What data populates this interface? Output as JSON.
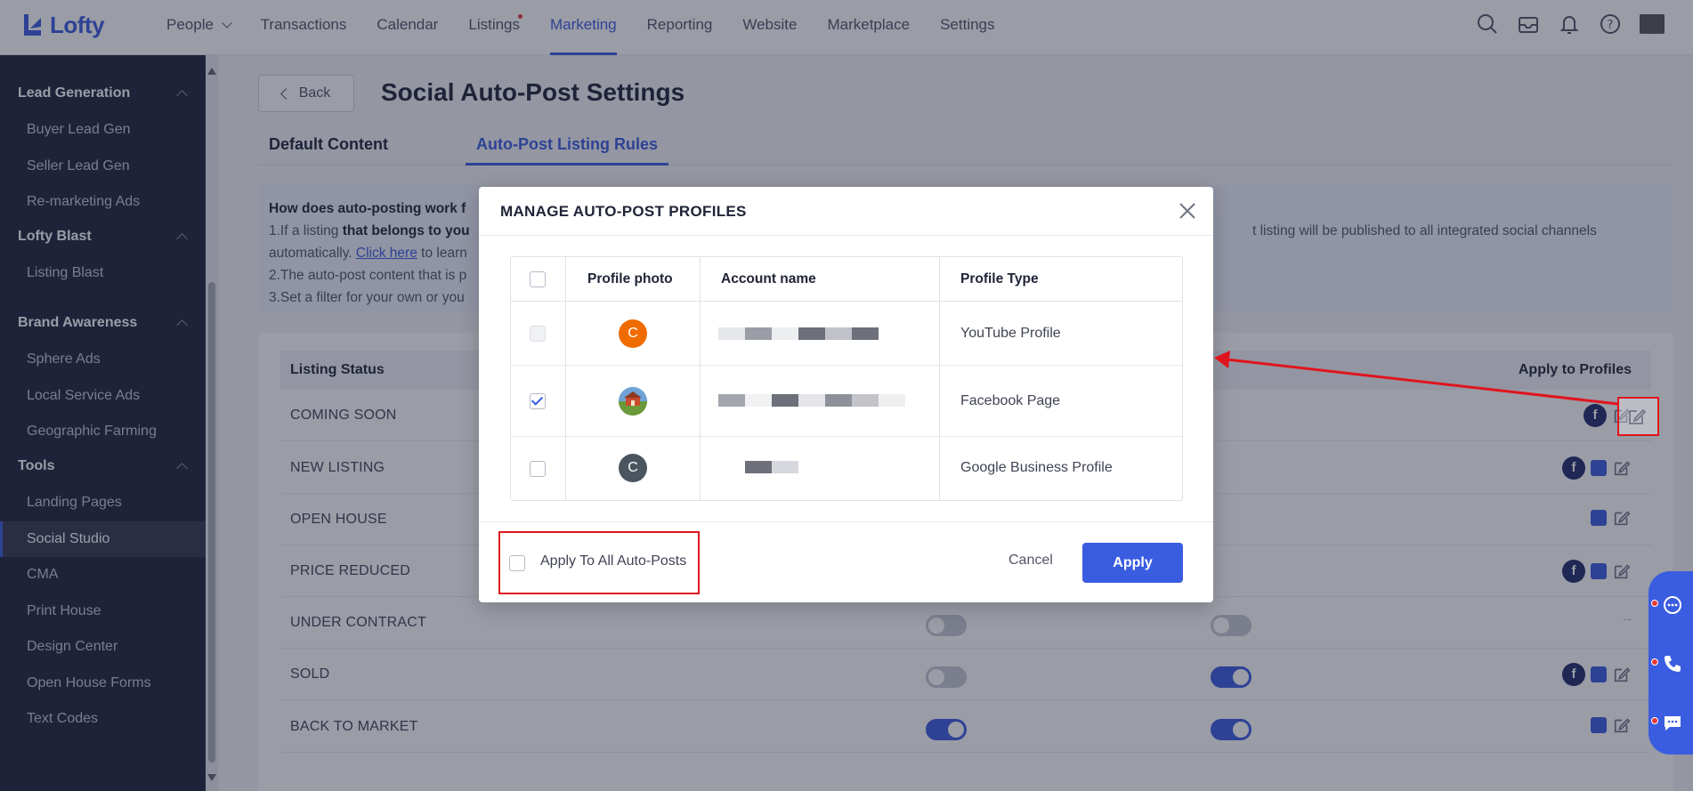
{
  "app": {
    "brand": "Lofty"
  },
  "nav": {
    "items": [
      "People",
      "Transactions",
      "Calendar",
      "Listings",
      "Marketing",
      "Reporting",
      "Website",
      "Marketplace",
      "Settings"
    ],
    "active": "Marketing"
  },
  "sidebar": {
    "groups": [
      {
        "title": "Lead Generation",
        "items": [
          "Buyer Lead Gen",
          "Seller Lead Gen",
          "Re-marketing Ads"
        ]
      },
      {
        "title": "Lofty Blast",
        "items": [
          "Listing Blast"
        ]
      },
      {
        "title": "Brand Awareness",
        "items": [
          "Sphere Ads",
          "Local Service Ads",
          "Geographic Farming"
        ]
      },
      {
        "title": "Tools",
        "items": [
          "Landing Pages",
          "Social Studio",
          "CMA",
          "Print House",
          "Design Center",
          "Open House Forms",
          "Text Codes"
        ]
      }
    ],
    "active_item": "Social Studio"
  },
  "page": {
    "back_label": "Back",
    "title": "Social Auto-Post Settings",
    "tabs": [
      "Default Content",
      "Auto-Post Listing Rules"
    ],
    "active_tab": "Auto-Post Listing Rules"
  },
  "info": {
    "question": "How does auto-posting work f",
    "line1_a": "1.If a listing ",
    "line1_b": "that belongs to you",
    "line1_c": "t listing will be published to all integrated social channels",
    "line1_d": "automatically. ",
    "line1_link": "Click here",
    "line1_e": " to learn",
    "line2": "2.The auto-post content that is p",
    "line3": "3.Set a filter for your own or you"
  },
  "listing_table": {
    "header_status": "Listing Status",
    "header_profiles": "Apply to Profiles",
    "rows": [
      {
        "status": "COMING SOON",
        "toggle_a": null,
        "toggle_b": null,
        "icons": [
          "facebook"
        ]
      },
      {
        "status": "NEW LISTING",
        "toggle_a": null,
        "toggle_b": null,
        "icons": [
          "facebook",
          "google"
        ]
      },
      {
        "status": "OPEN HOUSE",
        "toggle_a": null,
        "toggle_b": null,
        "icons": [
          "google"
        ]
      },
      {
        "status": "PRICE REDUCED",
        "toggle_a": null,
        "toggle_b": null,
        "icons": [
          "facebook",
          "google"
        ]
      },
      {
        "status": "UNDER CONTRACT",
        "toggle_a": false,
        "toggle_b": false,
        "icons": []
      },
      {
        "status": "SOLD",
        "toggle_a": false,
        "toggle_b": true,
        "icons": [
          "facebook",
          "google"
        ]
      },
      {
        "status": "BACK TO MARKET",
        "toggle_a": true,
        "toggle_b": true,
        "icons": [
          "google"
        ]
      }
    ],
    "empty_profiles": "--"
  },
  "modal": {
    "title": "MANAGE AUTO-POST PROFILES",
    "columns": [
      "Profile photo",
      "Account name",
      "Profile Type"
    ],
    "rows": [
      {
        "avatar_letter": "C",
        "avatar_color": "#ef6c00",
        "profile_type": "YouTube Profile",
        "checked": false,
        "disabled": true
      },
      {
        "avatar_letter": "",
        "avatar_color": "#6a9a3a",
        "profile_type": "Facebook Page",
        "checked": true,
        "disabled": false
      },
      {
        "avatar_letter": "C",
        "avatar_color": "#4a5560",
        "profile_type": "Google Business Profile",
        "checked": false,
        "disabled": false
      }
    ],
    "apply_all_label": "Apply To All Auto-Posts",
    "cancel_label": "Cancel",
    "apply_label": "Apply"
  },
  "colors": {
    "accent": "#3a5ce0",
    "sidebar_bg": "#1f2439",
    "annotation_red": "#e0141e"
  }
}
